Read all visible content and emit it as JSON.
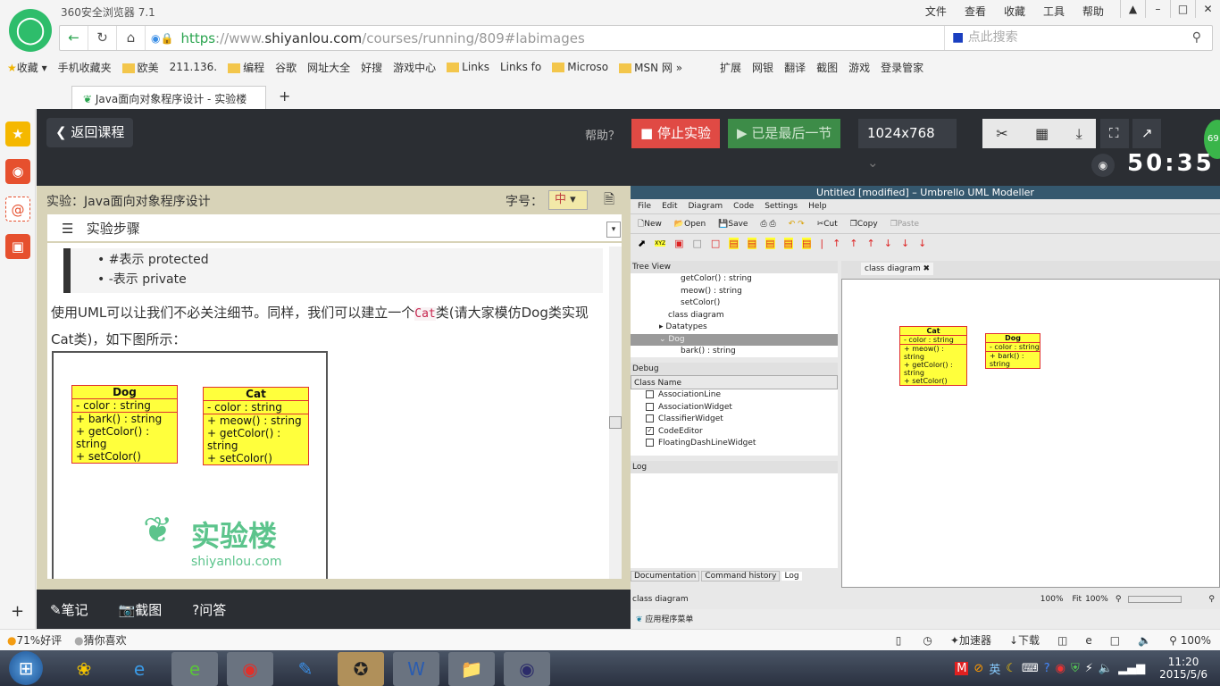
{
  "browser": {
    "title": "360安全浏览器 7.1",
    "menu": [
      "文件",
      "查看",
      "收藏",
      "工具",
      "帮助"
    ],
    "url_scheme": "https",
    "url_sep": "://www.",
    "url_domain": "shiyanlou.com",
    "url_path": "/courses/running/809#labimages",
    "search_placeholder": "点此搜索",
    "bookmarks": [
      "收藏",
      "手机收藏夹",
      "欧美",
      "211.136.",
      "编程",
      "谷歌",
      "网址大全",
      "好搜",
      "游戏中心",
      "Links",
      "Links fo",
      "Microso",
      "MSN 网"
    ],
    "extensions": [
      "扩展",
      "网银",
      "翻译",
      "截图",
      "游戏",
      "登录管家"
    ],
    "tab_title": "Java面向对象程序设计 - 实验楼"
  },
  "lab": {
    "back": "返回课程",
    "help": "帮助？",
    "stop": "停止实验",
    "last": "已是最后一节",
    "resolution": "1024x768",
    "timer": "50:35",
    "badge": "69",
    "course_title": "实验：Java面向对象程序设计",
    "font_label": "字号：",
    "font_value": "中",
    "steps": "实验步骤",
    "bullets": [
      "#表示 protected",
      "-表示 private"
    ],
    "para1": "使用UML可以让我们不必关注细节。同样，我们可以建立一个",
    "code": "Cat",
    "para2": "类(请大家模仿Dog类实现Cat类)，如下图所示：",
    "watermark_cn": "实验楼",
    "watermark_en": "shiyanlou.com",
    "bottom": [
      "笔记",
      "截图",
      "问答"
    ]
  },
  "uml": {
    "dog": {
      "name": "Dog",
      "attr": "- color : string",
      "ops": [
        "+ bark() : string",
        "+ getColor() : string",
        "+ setColor()"
      ]
    },
    "cat": {
      "name": "Cat",
      "attr": "- color : string",
      "ops": [
        "+ meow() : string",
        "+ getColor() : string",
        "+ setColor()"
      ]
    }
  },
  "umbrello": {
    "title": "Untitled [modified] – Umbrello UML Modeller",
    "menu": [
      "File",
      "Edit",
      "Diagram",
      "Code",
      "Settings",
      "Help"
    ],
    "toolbar": [
      "New",
      "Open",
      "Save",
      "Cut",
      "Copy",
      "Paste"
    ],
    "tree_title": "Tree View",
    "tree": [
      "getColor() : string",
      "meow() : string",
      "setColor()",
      "class diagram",
      "Datatypes",
      "Dog",
      "bark() : string"
    ],
    "debug_title": "Debug",
    "debug_header": "Class Name",
    "debug": [
      {
        "n": "AssociationLine",
        "c": false
      },
      {
        "n": "AssociationWidget",
        "c": false
      },
      {
        "n": "ClassifierWidget",
        "c": false
      },
      {
        "n": "CodeEditor",
        "c": true
      },
      {
        "n": "FloatingDashLineWidget",
        "c": false
      }
    ],
    "log_title": "Log",
    "diagram_tab": "class diagram",
    "bottom_tabs": [
      "Documentation",
      "Command history",
      "Log"
    ],
    "status": "class diagram",
    "zoom": "100%",
    "fit": "Fit",
    "zoom2": "100%",
    "app_menu": "应用程序菜单"
  },
  "statusbar": {
    "rating": "71%好评",
    "guess": "猜你喜欢",
    "accel": "加速器",
    "download": "下载",
    "zoom": "100%"
  },
  "tray": {
    "ime": "英",
    "time": "11:20",
    "date": "2015/5/6"
  }
}
